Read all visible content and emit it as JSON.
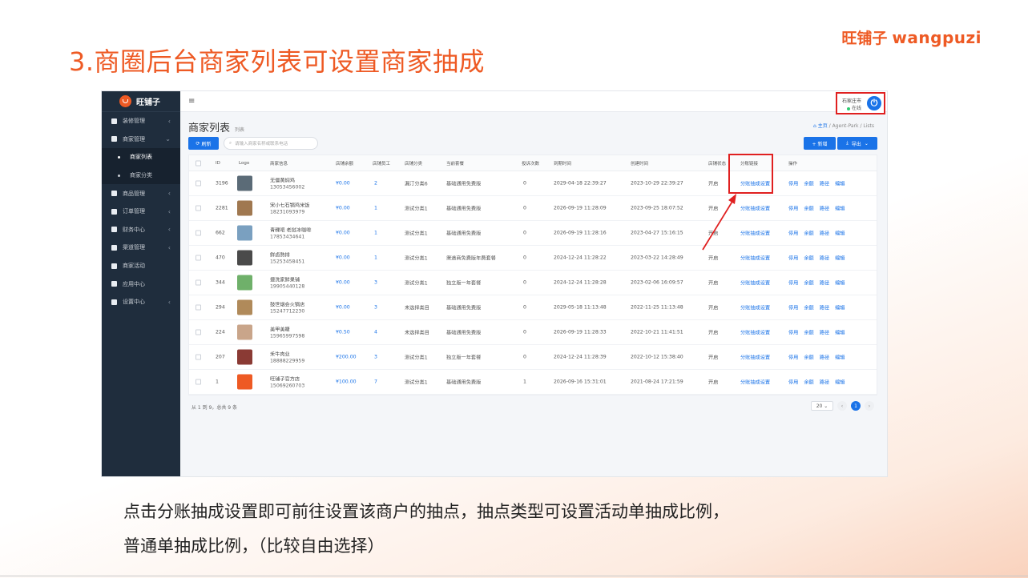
{
  "slide": {
    "title": "3.商圈后台商家列表可设置商家抽成",
    "brand_cn": "旺铺子",
    "brand_en": "wangpuzi",
    "caption_line1": "点击分账抽成设置即可前往设置该商户的抽点，抽点类型可设置活动单抽成比例，",
    "caption_line2": "普通单抽成比例，（比较自由选择）"
  },
  "app": {
    "logo_text": "旺铺子",
    "menu_icon": "≡",
    "user_name": "石家庄市",
    "user_status": "在线"
  },
  "sidebar": {
    "items": [
      {
        "label": "装修管理",
        "icon": "decor-icon",
        "chev": "‹"
      },
      {
        "label": "商家管理",
        "icon": "shop-icon",
        "chev": "⌄"
      },
      {
        "label": "商家列表",
        "sub": true,
        "active": true
      },
      {
        "label": "商家分类",
        "sub": true,
        "active": false
      },
      {
        "label": "商品管理",
        "icon": "goods-icon",
        "chev": "‹"
      },
      {
        "label": "订单管理",
        "icon": "order-icon",
        "chev": "‹"
      },
      {
        "label": "财务中心",
        "icon": "finance-icon",
        "chev": "‹"
      },
      {
        "label": "渠道管理",
        "icon": "channel-icon",
        "chev": "‹"
      },
      {
        "label": "商家活动",
        "icon": "activity-icon",
        "chev": ""
      },
      {
        "label": "应用中心",
        "icon": "apps-icon",
        "chev": ""
      },
      {
        "label": "设置中心",
        "icon": "settings-icon",
        "chev": "‹"
      }
    ]
  },
  "page": {
    "title": "商家列表",
    "subtitle": "列表",
    "breadcrumb": [
      "主页",
      "Agent-Park",
      "Lists"
    ]
  },
  "toolbar": {
    "refresh_label": "刷新",
    "search_placeholder": "请输入商家名称或联系电话",
    "add_label": "+ 新增",
    "export_label": "导出"
  },
  "table": {
    "headers": [
      "ID",
      "Logo",
      "商家信息",
      "店铺余额",
      "店铺员工",
      "店铺分类",
      "当前套餐",
      "投诉次数",
      "到期时间",
      "创建时间",
      "店铺状态",
      "分账链接",
      "操作"
    ],
    "rows": [
      {
        "id": "3196",
        "name": "无僵黄焖鸡",
        "phone": "13053456002",
        "balance": "¥0.00",
        "staff": "2",
        "category": "漏汀分类6",
        "plan": "基础通用免费版",
        "complaints": "0",
        "expire": "2029-04-18 22:39:27",
        "created": "2023-10-29 22:39:27",
        "status": "开启",
        "logo_color": "#5b6b77"
      },
      {
        "id": "2281",
        "name": "宋小七石锅鸡米饭",
        "phone": "18231093979",
        "balance": "¥0.00",
        "staff": "1",
        "category": "测试分类1",
        "plan": "基础通用免费版",
        "complaints": "0",
        "expire": "2026-09-19 11:28:09",
        "created": "2023-09-25 18:07:52",
        "status": "开启",
        "logo_color": "#a07850"
      },
      {
        "id": "662",
        "name": "青稞吧 老挝冰咖啡",
        "phone": "17853434641",
        "balance": "¥0.00",
        "staff": "1",
        "category": "测试分类1",
        "plan": "基础通用免费版",
        "complaints": "0",
        "expire": "2026-09-19 11:28:16",
        "created": "2023-04-27 15:16:15",
        "status": "开启",
        "logo_color": "#7aa0c0"
      },
      {
        "id": "470",
        "name": "鲜卤熟排",
        "phone": "15253458451",
        "balance": "¥0.00",
        "staff": "1",
        "category": "测试分类1",
        "plan": "渠道商免费版年费套餐",
        "complaints": "0",
        "expire": "2024-12-24 11:28:22",
        "created": "2023-03-22 14:28:49",
        "status": "开启",
        "logo_color": "#4a4a4a"
      },
      {
        "id": "344",
        "name": "捷洗家鲜果铺",
        "phone": "19905440128",
        "balance": "¥0.00",
        "staff": "3",
        "category": "测试分类1",
        "plan": "独立版一年套餐",
        "complaints": "0",
        "expire": "2024-12-24 11:28:28",
        "created": "2023-02-06 16:09:57",
        "status": "开启",
        "logo_color": "#6fb06a"
      },
      {
        "id": "294",
        "name": "鼓世烟会火锅店",
        "phone": "15247712230",
        "balance": "¥0.00",
        "staff": "3",
        "category": "未选择类目",
        "plan": "基础通用免费版",
        "complaints": "0",
        "expire": "2029-05-18 11:13:48",
        "created": "2022-11-25 11:13:48",
        "status": "开启",
        "logo_color": "#b08a5a"
      },
      {
        "id": "224",
        "name": "美甲美睫",
        "phone": "15965997598",
        "balance": "¥0.50",
        "staff": "4",
        "category": "未选择类目",
        "plan": "基础通用免费版",
        "complaints": "0",
        "expire": "2026-09-19 11:28:33",
        "created": "2022-10-21 11:41:51",
        "status": "开启",
        "logo_color": "#c9a58a"
      },
      {
        "id": "207",
        "name": "禾牛肉业",
        "phone": "18888229959",
        "balance": "¥200.00",
        "staff": "3",
        "category": "测试分类1",
        "plan": "独立版一年套餐",
        "complaints": "0",
        "expire": "2024-12-24 11:28:39",
        "created": "2022-10-12 15:38:40",
        "status": "开启",
        "logo_color": "#8a3a34"
      },
      {
        "id": "1",
        "name": "旺铺子官方店",
        "phone": "15069260703",
        "balance": "¥100.00",
        "staff": "7",
        "category": "测试分类1",
        "plan": "基础通用免费版",
        "complaints": "1",
        "expire": "2026-09-16 15:31:01",
        "created": "2021-08-24 17:21:59",
        "status": "开启",
        "logo_color": "#ee5a24"
      }
    ],
    "split_link_label": "分账抽成设置",
    "ops": [
      "停用",
      "余额",
      "路径",
      "编辑"
    ]
  },
  "pagination": {
    "info": "从 1 到 9，总共 9 条",
    "page_size": "20",
    "current": "1"
  },
  "colors": {
    "accent": "#1a73e8",
    "brand": "#ee5a24",
    "highlight": "#e02020",
    "sidebar": "#1f2d3d"
  }
}
